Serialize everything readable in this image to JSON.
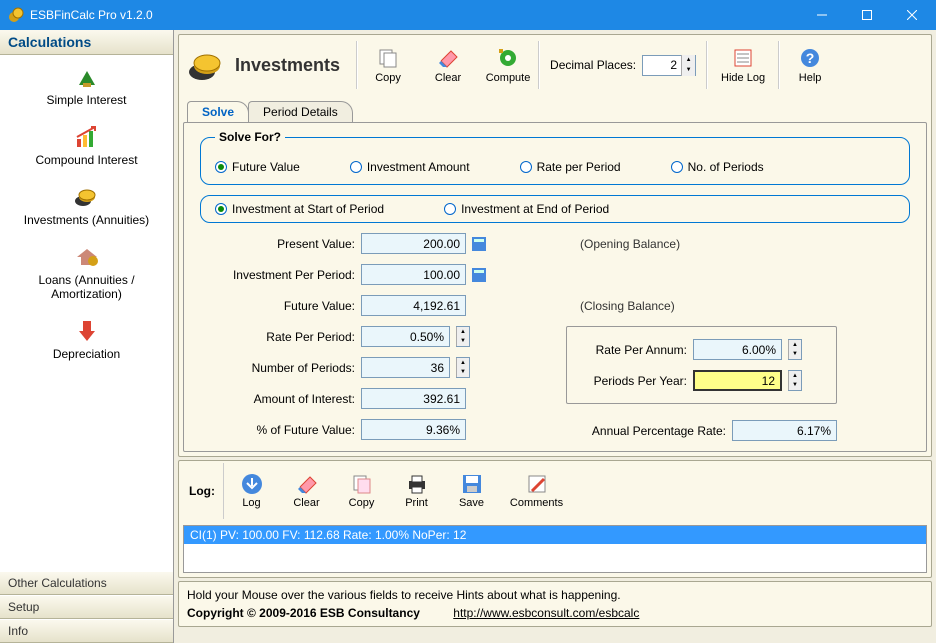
{
  "window": {
    "title": "ESBFinCalc Pro v1.2.0"
  },
  "sidebar": {
    "header": "Calculations",
    "items": [
      {
        "label": "Simple Interest"
      },
      {
        "label": "Compound Interest"
      },
      {
        "label": "Investments (Annuities)"
      },
      {
        "label": "Loans (Annuities / Amortization)"
      },
      {
        "label": "Depreciation"
      }
    ],
    "sections": [
      "Other Calculations",
      "Setup",
      "Info"
    ]
  },
  "page": {
    "title": "Investments"
  },
  "toolbar": {
    "copy": "Copy",
    "clear": "Clear",
    "compute": "Compute",
    "dp_label": "Decimal Places:",
    "dp_value": "2",
    "hidelog": "Hide Log",
    "help": "Help"
  },
  "tabs": {
    "solve": "Solve",
    "period": "Period Details"
  },
  "solve": {
    "legend": "Solve For?",
    "opts": {
      "fv": "Future Value",
      "ia": "Investment Amount",
      "rpp": "Rate per Period",
      "nop": "No. of Periods"
    },
    "timing": {
      "start": "Investment at Start of Period",
      "end": "Investment at End of Period"
    },
    "labels": {
      "pv": "Present Value:",
      "ipp": "Investment Per Period:",
      "fv": "Future Value:",
      "rpp": "Rate Per Period:",
      "nop": "Number of Periods:",
      "aoi": "Amount of Interest:",
      "pfv": "% of Future Value:",
      "open": "(Opening Balance)",
      "close": "(Closing Balance)",
      "rpa": "Rate Per Annum:",
      "ppy": "Periods Per Year:",
      "apr": "Annual Percentage Rate:"
    },
    "values": {
      "pv": "200.00",
      "ipp": "100.00",
      "fv": "4,192.61",
      "rpp": "0.50%",
      "nop": "36",
      "aoi": "392.61",
      "pfv": "9.36%",
      "rpa": "6.00%",
      "ppy": "12",
      "apr": "6.17%"
    }
  },
  "log": {
    "title": "Log:",
    "btns": {
      "log": "Log",
      "clear": "Clear",
      "copy": "Copy",
      "print": "Print",
      "save": "Save",
      "comments": "Comments"
    },
    "line": "CI(1) PV: 100.00 FV: 112.68 Rate: 1.00% NoPer: 12"
  },
  "footer": {
    "hint": "Hold your Mouse over the various fields to receive Hints about what is happening.",
    "copy": "Copyright © 2009-2016 ESB Consultancy",
    "url": "http://www.esbconsult.com/esbcalc"
  }
}
